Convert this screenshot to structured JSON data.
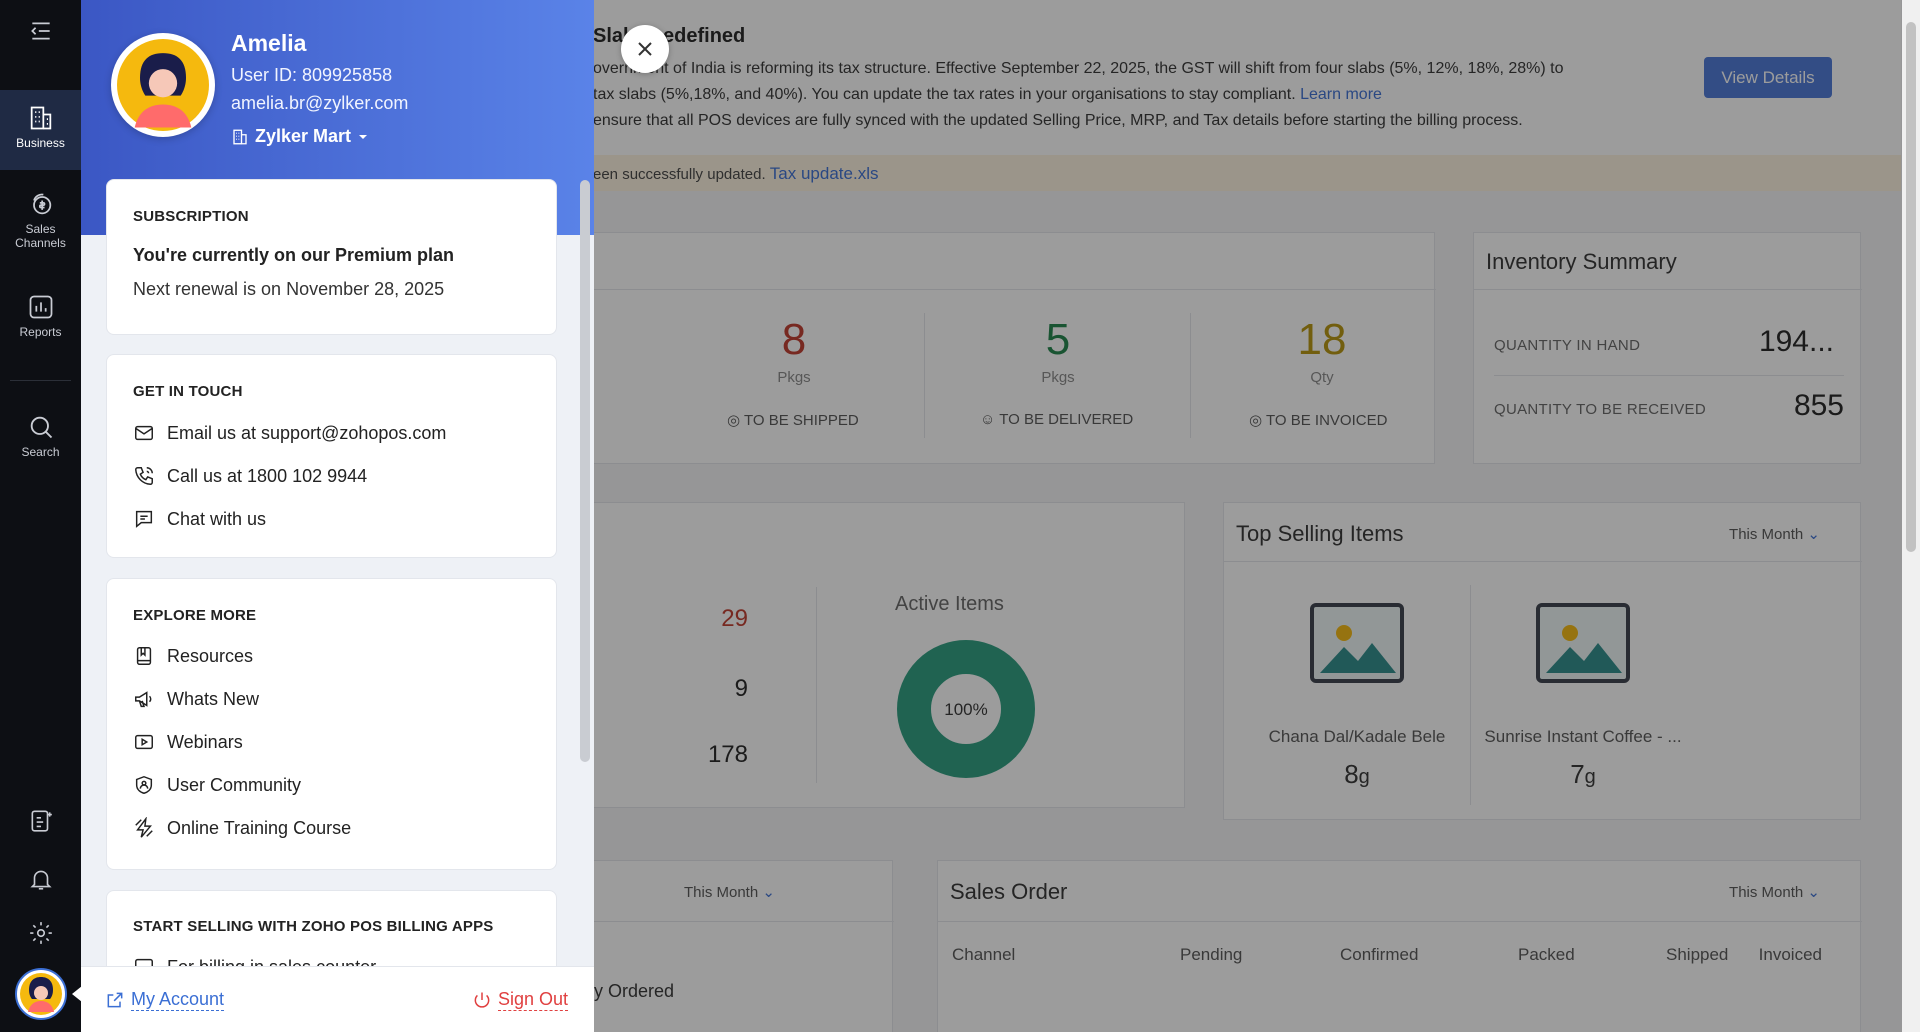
{
  "rail": {
    "items": [
      {
        "label": "Business",
        "icon": "building-icon"
      },
      {
        "label": "Sales Channels",
        "icon": "coins-icon"
      },
      {
        "label": "Reports",
        "icon": "bar-chart-icon"
      },
      {
        "label": "Search",
        "icon": "search-icon"
      }
    ]
  },
  "dashboard": {
    "banner": {
      "title": "Slab ... edefined",
      "line1": "overnment of India is reforming its tax structure. Effective September 22, 2025, the GST will shift from four slabs (5%, 12%, 18%, 28%) to",
      "line2_prefix": "tax slabs (5%,18%, and 40%). You can update the tax rates in your organisations to stay compliant.",
      "line2_link": "Learn more",
      "line3": "ensure that all POS devices are fully synced with the updated Selling Price, MRP, and Tax details before starting the billing process.",
      "view_details": "View Details"
    },
    "notice": {
      "text": "een successfully updated.",
      "file": "Tax update.xls"
    },
    "activity": [
      {
        "value": "8",
        "unit": "Pkgs",
        "label": "TO BE SHIPPED",
        "color": "#c0392b"
      },
      {
        "value": "5",
        "unit": "Pkgs",
        "label": "TO BE DELIVERED",
        "color": "#1e8449"
      },
      {
        "value": "18",
        "unit": "Qty",
        "label": "TO BE INVOICED",
        "color": "#b7950b"
      }
    ],
    "inventory": {
      "title": "Inventory Summary",
      "rows": [
        {
          "label": "QUANTITY IN HAND",
          "value": "194..."
        },
        {
          "label": "QUANTITY TO BE RECEIVED",
          "value": "855"
        }
      ]
    },
    "product": {
      "values": [
        {
          "value": "29",
          "color": "#c0392b"
        },
        {
          "value": "9",
          "color": "#222"
        },
        {
          "value": "178",
          "color": "#222"
        }
      ],
      "active_title": "Active Items",
      "donut_label": "100%"
    },
    "top_selling": {
      "title": "Top Selling Items",
      "period": "This Month",
      "items": [
        {
          "name": "Chana Dal/Kadale Bele",
          "qty": "8",
          "unit": "g"
        },
        {
          "name": "Sunrise Instant Coffee - ...",
          "qty": "7",
          "unit": "g"
        }
      ]
    },
    "purchase": {
      "period": "This Month",
      "row_label": "y Ordered"
    },
    "sales_order": {
      "title": "Sales Order",
      "period": "This Month",
      "columns": [
        "Channel",
        "Pending",
        "Confirmed",
        "Packed",
        "Shipped",
        "Invoiced"
      ]
    }
  },
  "drawer": {
    "user": {
      "name": "Amelia",
      "user_id": "User ID: 809925858",
      "email": "amelia.br@zylker.com",
      "org": "Zylker Mart"
    },
    "subscription": {
      "heading": "SUBSCRIPTION",
      "plan": "You're currently on our Premium plan",
      "renewal": "Next renewal is on November 28, 2025"
    },
    "get_in_touch": {
      "heading": "GET IN TOUCH",
      "email": "Email us at support@zohopos.com",
      "call": "Call us at 1800 102 9944",
      "chat": "Chat with us"
    },
    "explore": {
      "heading": "EXPLORE MORE",
      "items": [
        "Resources",
        "Whats New",
        "Webinars",
        "User Community",
        "Online Training Course"
      ]
    },
    "billing_apps": {
      "heading": "START SELLING WITH ZOHO POS BILLING APPS",
      "first_item": "For billing in sales counter"
    },
    "footer": {
      "my_account": "My Account",
      "sign_out": "Sign Out"
    }
  },
  "colors": {
    "accent": "#3b6fd4",
    "hero_start": "#3b57c4",
    "hero_end": "#5a83e8",
    "rail_bg": "#0d0f14",
    "sign_out": "#e04040",
    "donut": "#2a9d7f"
  }
}
